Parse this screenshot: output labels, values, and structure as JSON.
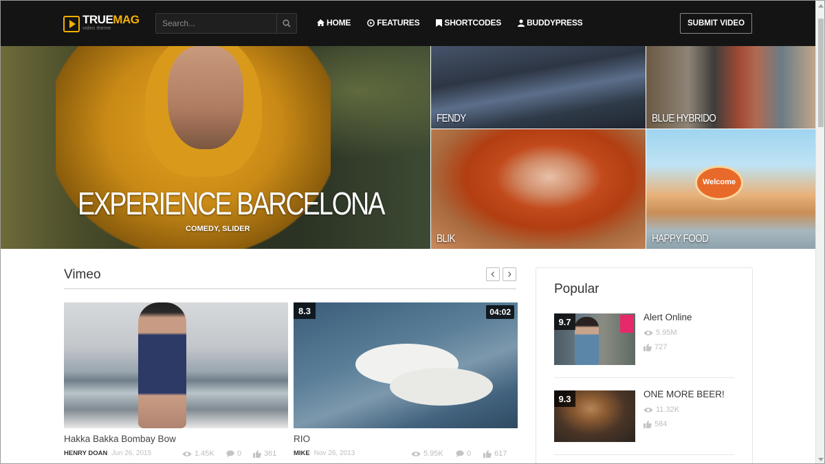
{
  "header": {
    "logo_true": "TRUE",
    "logo_mag": "MAG",
    "logo_sub": "video theme",
    "search_placeholder": "Search...",
    "nav": [
      {
        "label": "HOME",
        "icon": "home-icon"
      },
      {
        "label": "FEATURES",
        "icon": "play-circle-icon"
      },
      {
        "label": "SHORTCODES",
        "icon": "bookmark-icon"
      },
      {
        "label": "BUDDYPRESS",
        "icon": "user-icon"
      }
    ],
    "submit_label": "SUBMIT VIDEO"
  },
  "hero": {
    "title": "EXPERIENCE BARCELONA",
    "categories": "COMEDY, SLIDER",
    "tiles": [
      "FENDY",
      "BLUE HYBRIDO",
      "BLIK",
      "HAPPY FOOD"
    ],
    "welcome_sign": "Welcome"
  },
  "vimeo": {
    "title": "Vimeo",
    "cards": [
      {
        "title": "Hakka Bakka Bombay Bow",
        "author": "HENRY DOAN",
        "date": "Jun 26, 2015",
        "views": "1.45K",
        "comments": "0",
        "likes": "361"
      },
      {
        "title": "RIO",
        "author": "MIKE",
        "date": "Nov 26, 2013",
        "views": "5.95K",
        "comments": "0",
        "likes": "617",
        "score": "8.3",
        "duration": "04:02"
      }
    ]
  },
  "popular": {
    "title": "Popular",
    "items": [
      {
        "title": "Alert Online",
        "score": "9.7",
        "views": "5.95M",
        "likes": "727"
      },
      {
        "title": "ONE MORE BEER!",
        "score": "9.3",
        "views": "11.32K",
        "likes": "584"
      }
    ]
  },
  "colors": {
    "accent": "#f5b100",
    "header_bg": "#141414"
  }
}
